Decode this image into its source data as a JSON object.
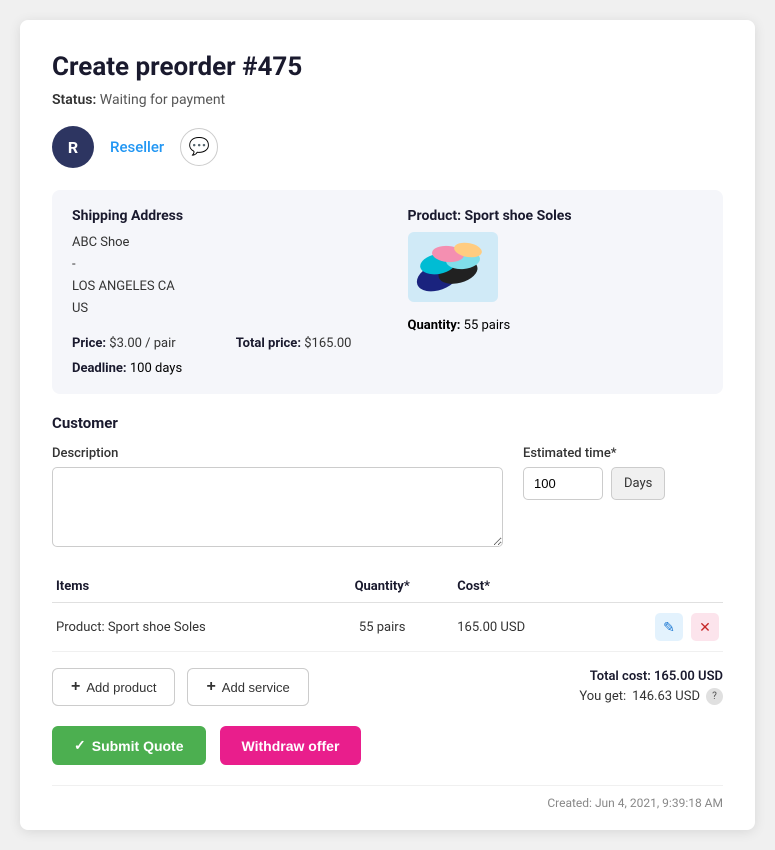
{
  "page": {
    "title": "Create preorder #475",
    "status_label": "Status:",
    "status_value": "Waiting for payment"
  },
  "user": {
    "avatar_initial": "R",
    "name": "Reseller"
  },
  "shipping": {
    "section_label": "Shipping Address",
    "company": "ABC Shoe",
    "dash": "-",
    "city_state": "LOS ANGELES CA",
    "country": "US"
  },
  "product": {
    "section_label": "Product: Sport shoe Soles",
    "quantity_label": "Quantity:",
    "quantity_value": "55 pairs"
  },
  "pricing": {
    "price_label": "Price:",
    "price_value": "$3.00 / pair",
    "total_price_label": "Total price:",
    "total_price_value": "$165.00",
    "deadline_label": "Deadline:",
    "deadline_value": "100 days"
  },
  "customer": {
    "section_title": "Customer",
    "description_label": "Description",
    "description_placeholder": "",
    "estimated_time_label": "Estimated time*",
    "estimated_time_value": "100",
    "days_label": "Days"
  },
  "table": {
    "col_items": "Items",
    "col_quantity": "Quantity*",
    "col_cost": "Cost*",
    "rows": [
      {
        "name": "Product: Sport shoe Soles",
        "quantity": "55 pairs",
        "cost": "165.00 USD"
      }
    ]
  },
  "buttons": {
    "add_product": "Add product",
    "add_service": "Add service",
    "submit_quote": "Submit Quote",
    "withdraw_offer": "Withdraw offer"
  },
  "totals": {
    "total_cost_label": "Total cost:",
    "total_cost_value": "165.00 USD",
    "you_get_label": "You get:",
    "you_get_value": "146.63 USD"
  },
  "footer": {
    "created_label": "Created: Jun 4, 2021, 9:39:18 AM"
  },
  "icons": {
    "chat": "💬",
    "plus": "+",
    "check": "✓",
    "edit": "✎",
    "delete": "✕",
    "info": "?"
  }
}
